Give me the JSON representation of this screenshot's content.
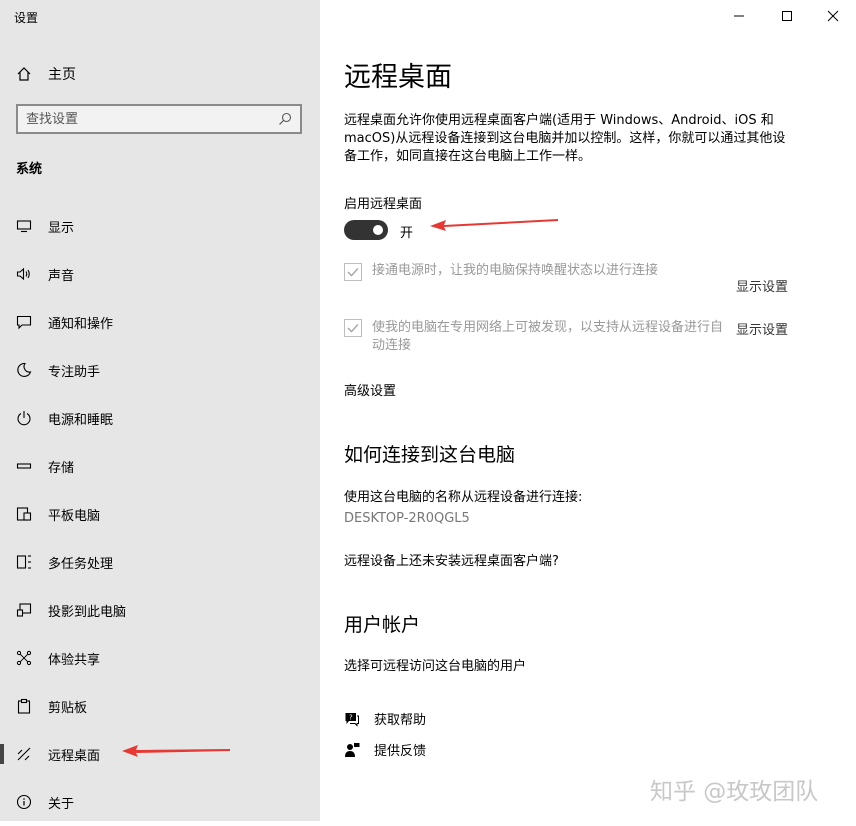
{
  "window_title": "设置",
  "sidebar": {
    "home": "主页",
    "search_placeholder": "查找设置",
    "section": "系统",
    "items": [
      {
        "label": "显示"
      },
      {
        "label": "声音"
      },
      {
        "label": "通知和操作"
      },
      {
        "label": "专注助手"
      },
      {
        "label": "电源和睡眠"
      },
      {
        "label": "存储"
      },
      {
        "label": "平板电脑"
      },
      {
        "label": "多任务处理"
      },
      {
        "label": "投影到此电脑"
      },
      {
        "label": "体验共享"
      },
      {
        "label": "剪贴板"
      },
      {
        "label": "远程桌面"
      },
      {
        "label": "关于"
      }
    ],
    "active_item": "远程桌面"
  },
  "main": {
    "title": "远程桌面",
    "description": "远程桌面允许你使用远程桌面客户端(适用于 Windows、Android、iOS 和 macOS)从远程设备连接到这台电脑并加以控制。这样，你就可以通过其他设备工作，如同直接在这台电脑上工作一样。",
    "enable_label": "启用远程桌面",
    "toggle_state": "开",
    "checkbox1": "接通电源时，让我的电脑保持唤醒状态以进行连接",
    "checkbox1_link": "显示设置",
    "checkbox2": "使我的电脑在专用网络上可被发现，以支持从远程设备进行自动连接",
    "checkbox2_link": "显示设置",
    "advanced": "高级设置",
    "connect_heading": "如何连接到这台电脑",
    "connect_text": "使用这台电脑的名称从远程设备进行连接:",
    "pc_name": "DESKTOP-2R0QGL5",
    "no_client": "远程设备上还未安装远程桌面客户端?",
    "accounts_heading": "用户帐户",
    "accounts_link": "选择可远程访问这台电脑的用户",
    "get_help": "获取帮助",
    "feedback": "提供反馈"
  },
  "watermark": "知乎 @玫玫团队",
  "colors": {
    "annotation_arrow": "#e53935",
    "sidebar_bg": "#e6e6e6",
    "toggle_on": "#333333"
  }
}
